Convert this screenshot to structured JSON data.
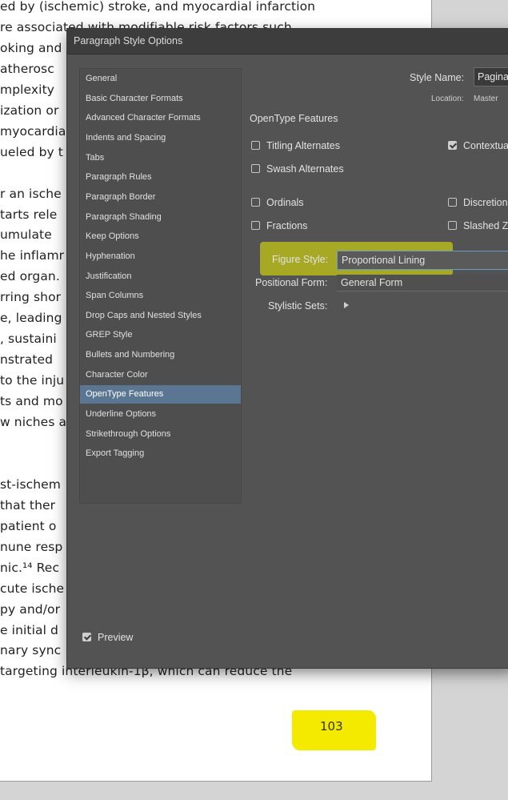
{
  "document": {
    "lines": [
      "ed by (ischemic) stroke, and myocardial infarction",
      "re associated with modifiable risk factors such",
      "oking and",
      "atherosc",
      "mplexity",
      "ization or",
      "myocardia",
      "ueled by t",
      "",
      "r an ische",
      "tarts rele",
      "umulate",
      "he inflamr",
      "ed organ.",
      "rring shor",
      "e, leading",
      ", sustaini",
      "nstrated",
      "to the inju",
      "ts and mo",
      "w niches a",
      "",
      "",
      "st-ischem",
      "that ther",
      "patient o",
      "nune resp",
      "nic.¹⁴ Rec",
      "cute ische",
      "py and/or",
      "e initial d",
      "nary sync",
      "targeting interleukin-1β, which can reduce the"
    ],
    "page_number": "103",
    "highlight_color": "#f4ea00"
  },
  "dialog": {
    "title": "Paragraph Style Options",
    "style_name_label": "Style Name:",
    "style_name_value": "Pagina",
    "location_label": "Location:",
    "location_value": "Master",
    "sidebar_items": [
      "General",
      "Basic Character Formats",
      "Advanced Character Formats",
      "Indents and Spacing",
      "Tabs",
      "Paragraph Rules",
      "Paragraph Border",
      "Paragraph Shading",
      "Keep Options",
      "Hyphenation",
      "Justification",
      "Span Columns",
      "Drop Caps and Nested Styles",
      "GREP Style",
      "Bullets and Numbering",
      "Character Color",
      "OpenType Features",
      "Underline Options",
      "Strikethrough Options",
      "Export Tagging"
    ],
    "selected_item": "OpenType Features",
    "panel": {
      "heading": "OpenType Features",
      "titling_alternates": "Titling Alternates",
      "swash_alternates": "Swash Alternates",
      "contextual": "Contextua",
      "ordinals": "Ordinals",
      "fractions": "Fractions",
      "discretionary": "Discretion",
      "slashed_zero": "Slashed Z",
      "figure_style_label": "Figure Style:",
      "figure_style_value": "Proportional Lining",
      "positional_form_label": "Positional Form:",
      "positional_form_value": "General Form",
      "stylistic_sets_label": "Stylistic Sets:"
    },
    "preview_label": "Preview",
    "selected_color": "#5a7692",
    "highlight_color": "#ecf000"
  }
}
